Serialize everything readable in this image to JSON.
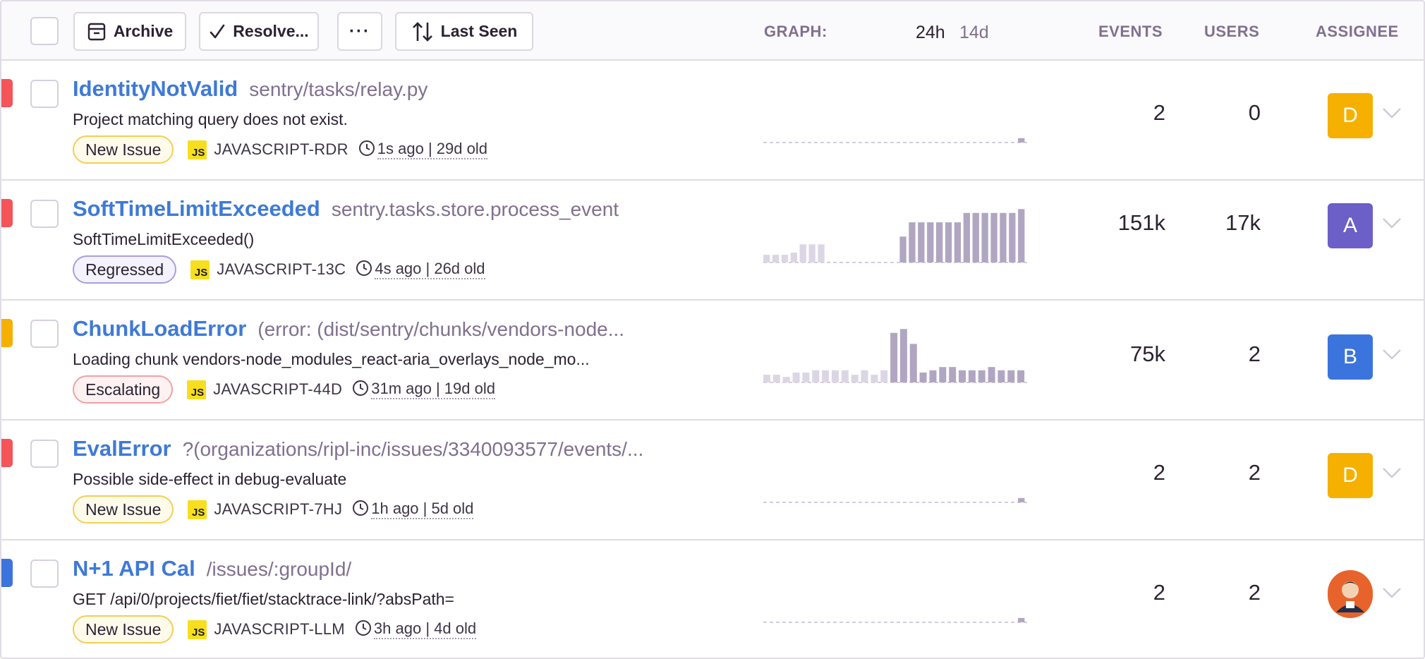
{
  "toolbar": {
    "archive_label": "Archive",
    "resolve_label": "Resolve...",
    "more_label": "···",
    "sort_label": "Last Seen",
    "graph_label": "GRAPH:",
    "period_24h": "24h",
    "period_14d": "14d",
    "events_header": "EVENTS",
    "users_header": "USERS",
    "assignee_header": "ASSIGNEE"
  },
  "colors": {
    "link": "#3e7ad6",
    "level_error": "#f55459",
    "level_warning": "#f5b000",
    "level_info": "#3c74dd",
    "bar": "#b1a6c2",
    "bar_light": "#dcd6e4"
  },
  "issues": [
    {
      "title": "IdentityNotValid",
      "culprit": "sentry/tasks/relay.py",
      "message": "Project matching query does not exist.",
      "status": "New Issue",
      "status_kind": "new",
      "platform_badge": "JS",
      "short_id": "JAVASCRIPT-RDR",
      "times": "1s ago | 29d old",
      "level": "error",
      "events": "2",
      "users": "0",
      "assignee_initial": "D",
      "assignee_color": "#f5b000",
      "sparkline": {
        "bars": [
          0,
          0,
          0,
          0,
          0,
          0,
          0,
          0,
          0,
          0,
          0,
          0,
          0,
          0,
          0,
          0,
          0,
          0,
          0,
          0,
          0,
          0,
          0,
          0,
          0,
          0,
          0,
          0,
          0.08
        ],
        "highlight_from": 0,
        "max": 1
      }
    },
    {
      "title": "SoftTimeLimitExceeded",
      "culprit": "sentry.tasks.store.process_event",
      "message": "SoftTimeLimitExceeded()",
      "status": "Regressed",
      "status_kind": "regressed",
      "platform_badge": "JS",
      "short_id": "JAVASCRIPT-13C",
      "times": "4s ago | 26d old",
      "level": "error",
      "events": "151k",
      "users": "17k",
      "assignee_initial": "A",
      "assignee_color": "#6c5fc7",
      "sparkline": {
        "bars": [
          0.14,
          0.14,
          0.14,
          0.18,
          0.33,
          0.33,
          0.33,
          0,
          0,
          0,
          0,
          0,
          0,
          0,
          0,
          0.47,
          0.73,
          0.73,
          0.73,
          0.73,
          0.73,
          0.73,
          0.9,
          0.9,
          0.9,
          0.9,
          0.9,
          0.9,
          0.97
        ],
        "highlight_from": 15,
        "max": 1
      }
    },
    {
      "title": "ChunkLoadError",
      "culprit": "(error: (dist/sentry/chunks/vendors-node...",
      "message": "Loading chunk vendors-node_modules_react-aria_overlays_node_mo...",
      "status": "Escalating",
      "status_kind": "escalating",
      "platform_badge": "JS",
      "short_id": "JAVASCRIPT-44D",
      "times": "31m ago | 19d old",
      "level": "warning",
      "events": "75k",
      "users": "2",
      "assignee_initial": "B",
      "assignee_color": "#3c74dd",
      "sparkline": {
        "bars": [
          0.14,
          0.14,
          0.1,
          0.18,
          0.18,
          0.22,
          0.22,
          0.22,
          0.22,
          0.14,
          0.22,
          0.14,
          0.22,
          0.9,
          0.97,
          0.7,
          0.18,
          0.22,
          0.28,
          0.28,
          0.22,
          0.22,
          0.22,
          0.28,
          0.22,
          0.22,
          0.22
        ],
        "highlight_from": 13,
        "max": 1
      }
    },
    {
      "title": "EvalError",
      "culprit": "?(organizations/ripl-inc/issues/3340093577/events/...",
      "message": "Possible side-effect in debug-evaluate",
      "status": "New Issue",
      "status_kind": "new",
      "platform_badge": "JS",
      "short_id": "JAVASCRIPT-7HJ",
      "times": "1h ago | 5d old",
      "level": "error",
      "events": "2",
      "users": "2",
      "assignee_initial": "D",
      "assignee_color": "#f5b000",
      "sparkline": {
        "bars": [
          0,
          0,
          0,
          0,
          0,
          0,
          0,
          0,
          0,
          0,
          0,
          0,
          0,
          0,
          0,
          0,
          0,
          0,
          0,
          0,
          0,
          0,
          0,
          0,
          0,
          0,
          0,
          0,
          0.08
        ],
        "highlight_from": 0,
        "max": 1
      }
    },
    {
      "title": "N+1 API Cal",
      "culprit": "/issues/:groupId/",
      "message": "GET /api/0/projects/fiet/fiet/stacktrace-link/?absPath=",
      "status": "New Issue",
      "status_kind": "new",
      "platform_badge": "JS",
      "short_id": "JAVASCRIPT-LLM",
      "times": "3h ago | 4d old",
      "level": "info",
      "events": "2",
      "users": "2",
      "assignee_initial": "",
      "assignee_color": "#e8632b",
      "sparkline": {
        "bars": [
          0,
          0,
          0,
          0,
          0,
          0,
          0,
          0,
          0,
          0,
          0,
          0,
          0,
          0,
          0,
          0,
          0,
          0,
          0,
          0,
          0,
          0,
          0,
          0,
          0,
          0,
          0,
          0,
          0.08
        ],
        "highlight_from": 0,
        "max": 1
      }
    }
  ]
}
